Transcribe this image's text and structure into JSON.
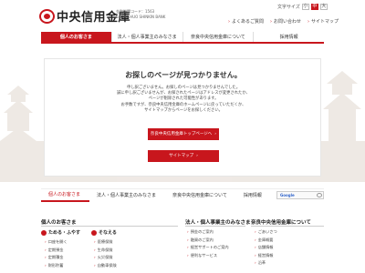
{
  "header": {
    "logo_text": "中央信用金庫",
    "bank_info": [
      "金融機関コード：1563",
      "SAGA CHUO SHINKIN BANK"
    ],
    "fontsize_label": "文字サイズ",
    "fontsize_options": [
      "小",
      "中",
      "大"
    ],
    "links": [
      "よくあるご質問",
      "お問い合わせ",
      "サイトマップ"
    ]
  },
  "gnav": {
    "items": [
      "個人のお客さま",
      "法人・個人事業主のみなさま",
      "奈良中央信用金庫について",
      "採用情報"
    ]
  },
  "main": {
    "title": "お探しのページが見つかりません。",
    "message": [
      "申し訳ございません。お探しのページは見つかりませんでした。",
      "誠に申し訳ございませんが、お探されたページはアドレスが変更されたか、",
      "ページが削除された可能性があります。",
      "お手数ですが、奈良中央信用金庫のホームページに戻っていただくか、",
      "サイトマップからページをお探しください。"
    ],
    "button_top": "奈良中央信用金庫トップページへ",
    "button_sitemap": "サイトマップ"
  },
  "footer_nav": {
    "items": [
      "個人のお客さま",
      "法人・個人事業主のみなさま",
      "奈良中央信用金庫について",
      "採用情報"
    ],
    "search_brand": "Google"
  },
  "footer": {
    "col1_title": "個人のお客さま",
    "col2_title": "法人・個人事業主のみなさま",
    "col3_title": "奈良中央信用金庫について",
    "sub1": "ためる・ふやす",
    "sub2": "そなえる",
    "links1": [
      "口座を開く",
      "定期預金",
      "定期積金",
      "財形貯蓄"
    ],
    "links2": [
      "医療保険",
      "生命保険",
      "火災保険",
      "自動車保険"
    ],
    "links3": [
      "預金のご案内",
      "融資のご案内",
      "経営サポートのご案内",
      "便利なサービス"
    ],
    "links4": [
      "ごあいさつ",
      "金庫概要",
      "店舗情報",
      "経営情報",
      "沿革"
    ]
  },
  "colors": {
    "brand": "#c8161d"
  }
}
